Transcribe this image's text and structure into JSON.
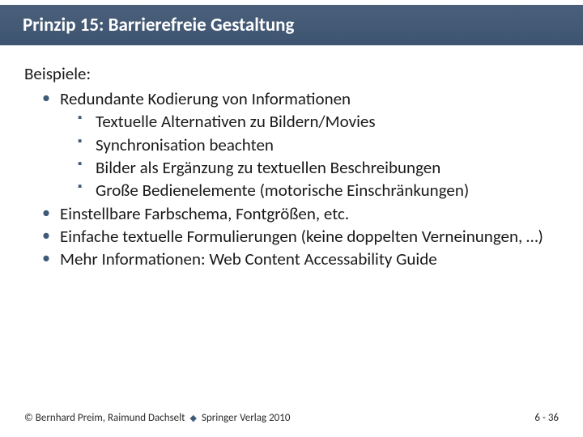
{
  "title": "Prinzip 15: Barrierefreie Gestaltung",
  "intro": "Beispiele:",
  "bullets": [
    {
      "text": "Redundante Kodierung von Informationen",
      "sub": [
        "Textuelle Alternativen zu Bildern/Movies",
        "Synchronisation beachten",
        "Bilder als Ergänzung zu textuellen Beschreibungen",
        "Große Bedienelemente (motorische Einschränkungen)"
      ]
    },
    {
      "text": "Einstellbare Farbschema, Fontgrößen, etc."
    },
    {
      "text": "Einfache textuelle Formulierungen (keine doppelten Verneinungen, …)"
    },
    {
      "text": "Mehr Informationen: Web Content Accessability Guide"
    }
  ],
  "footer": {
    "authors": "© Bernhard Preim, Raimund Dachselt",
    "publisher": "Springer Verlag 2010",
    "page": "6 - 36"
  }
}
